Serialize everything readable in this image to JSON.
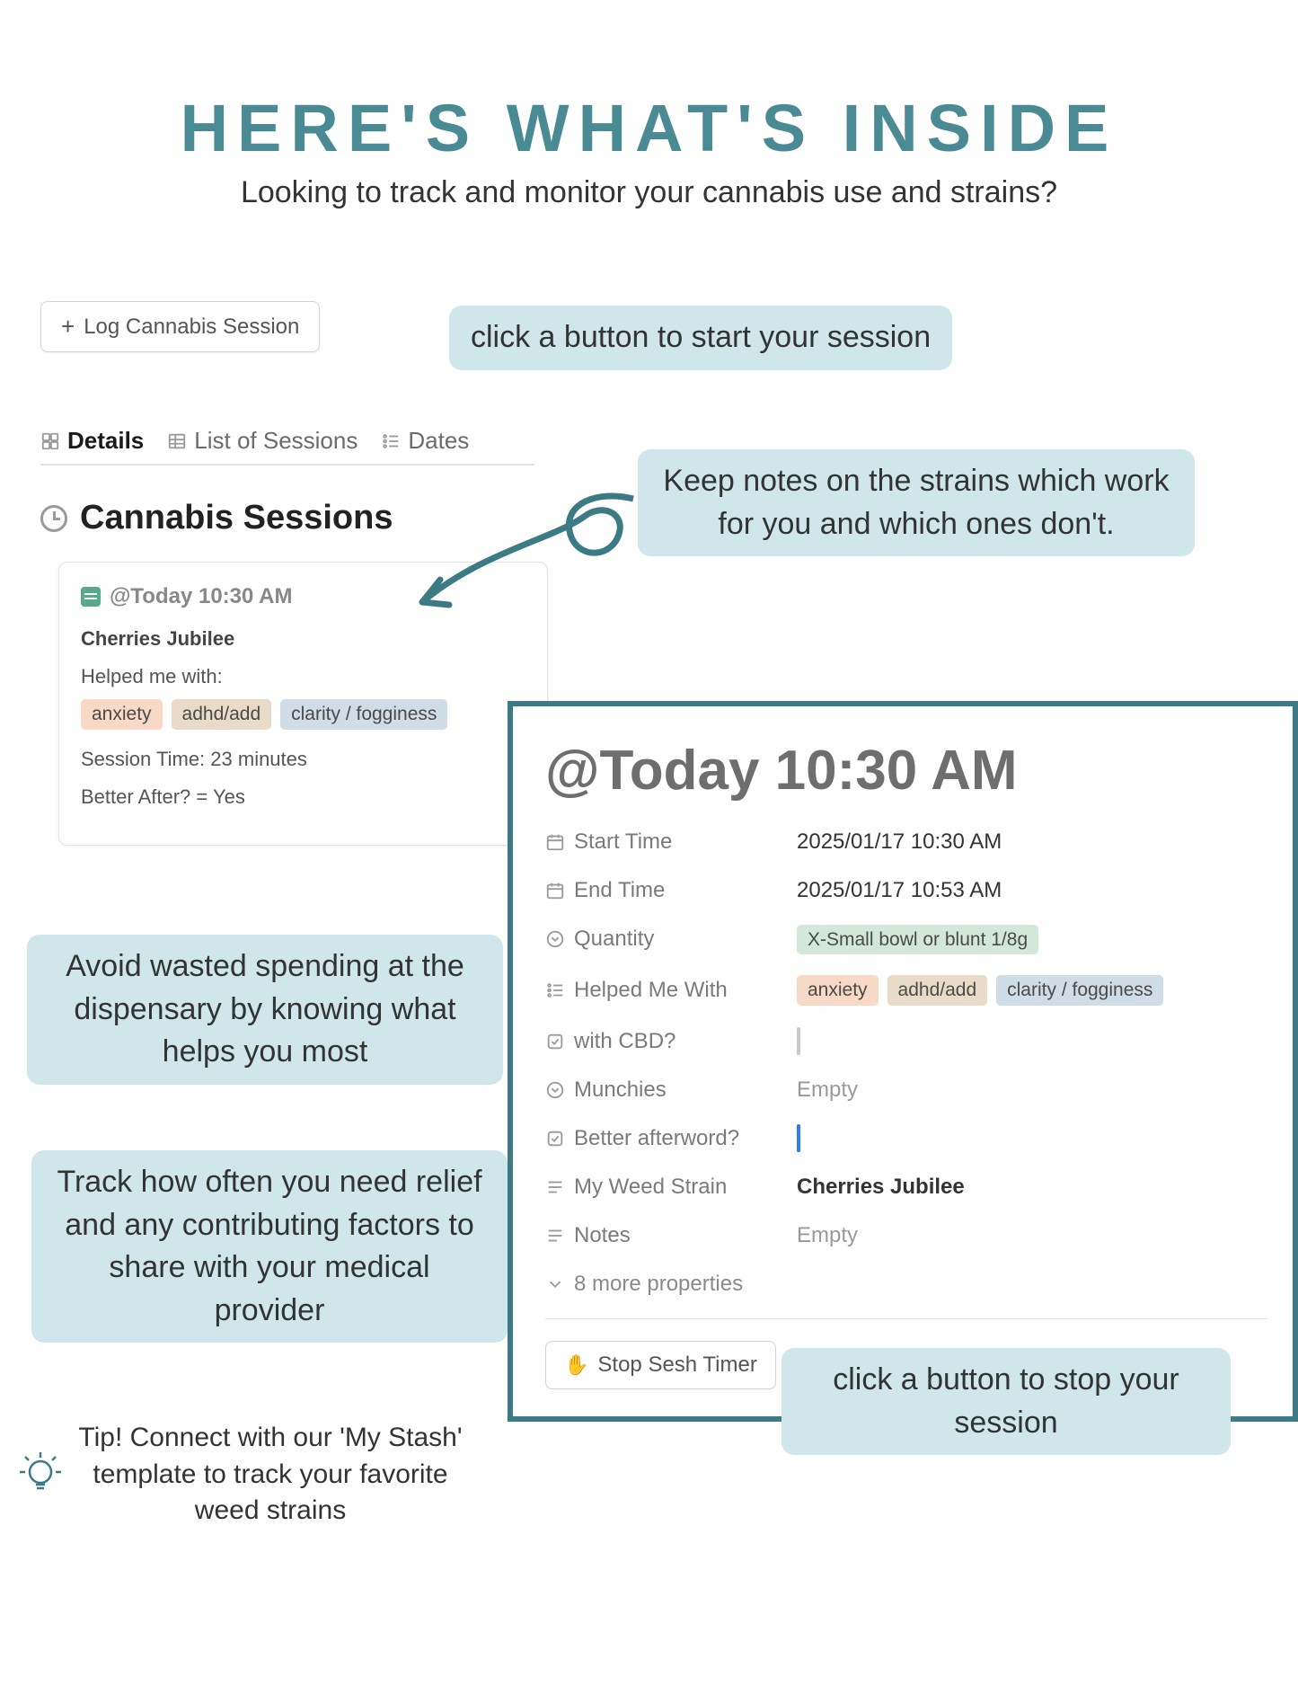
{
  "header": {
    "title": "HERE'S WHAT'S INSIDE",
    "subtitle": "Looking to track and monitor your cannabis use and strains?"
  },
  "log_button": {
    "label": "Log Cannabis Session"
  },
  "callouts": {
    "start": "click a button to start your session",
    "notes": "Keep notes on the strains which work for you and which ones don't.",
    "spending": "Avoid wasted spending at the dispensary by knowing what helps you most",
    "relief": "Track how often you need relief and any contributing factors to share with your medical provider",
    "stop": "click a button to stop your session"
  },
  "tabs": {
    "details": "Details",
    "list": "List of Sessions",
    "dates": "Dates"
  },
  "section_title": "Cannabis Sessions",
  "card": {
    "date": "@Today 10:30 AM",
    "strain": "Cherries Jubilee",
    "helped_label": "Helped me with:",
    "tags": {
      "anxiety": "anxiety",
      "adhd": "adhd/add",
      "clarity": "clarity / fogginess"
    },
    "session_time": "Session Time: 23 minutes",
    "better_after": "Better After? = Yes"
  },
  "detail": {
    "title": "@Today 10:30 AM",
    "start_time": {
      "label": "Start Time",
      "value": "2025/01/17 10:30 AM"
    },
    "end_time": {
      "label": "End Time",
      "value": "2025/01/17 10:53 AM"
    },
    "quantity": {
      "label": "Quantity",
      "value": "X-Small bowl or blunt 1/8g"
    },
    "helped": {
      "label": "Helped Me With"
    },
    "with_cbd": {
      "label": "with CBD?"
    },
    "munchies": {
      "label": "Munchies",
      "value": "Empty"
    },
    "better": {
      "label": "Better afterword?"
    },
    "strain": {
      "label": "My Weed Strain",
      "value": "Cherries Jubilee"
    },
    "notes": {
      "label": "Notes",
      "value": "Empty"
    },
    "more": "8 more properties",
    "stop_button": "Stop Sesh Timer"
  },
  "tip": "Tip! Connect with our 'My Stash' template to track your favorite weed strains"
}
